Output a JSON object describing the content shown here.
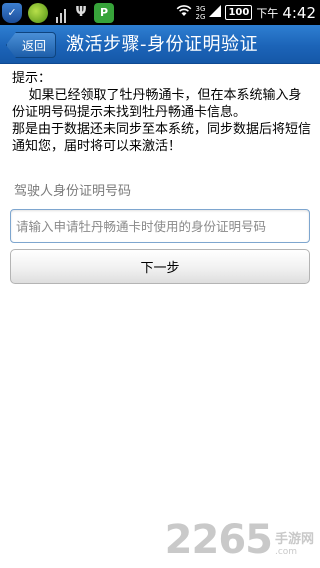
{
  "status_bar": {
    "left_icons": [
      "shield-app-icon",
      "leaf-app-icon",
      "signal-bars-icon",
      "usb-icon",
      "p-app-icon"
    ],
    "p_app_letter": "P",
    "wifi_icon": "wifi-icon",
    "network_top": "3G",
    "network_bottom": "2G",
    "battery": "100",
    "ampm": "下午",
    "time": "4:42"
  },
  "title_bar": {
    "back_label": "返回",
    "title": "激活步骤-身份证明验证"
  },
  "tip": {
    "label": "提示：",
    "text": "    如果已经领取了牡丹畅通卡，但在本系统输入身份证明号码提示未找到牡丹畅通卡信息。\n那是由于数据还未同步至本系统，同步数据后将短信通知您，届时将可以来激活！"
  },
  "form": {
    "field_label": "驾驶人身份证明号码",
    "id_placeholder": "请输入申请牡丹畅通卡时使用的身份证明号码",
    "id_value": "",
    "next_label": "下一步"
  },
  "watermark": {
    "number": "2265",
    "cn": "手游网",
    "domain": ".com"
  },
  "colors": {
    "title_bar": "#1c64b8",
    "status_bar": "#000000",
    "input_border": "#7ea6cf"
  }
}
